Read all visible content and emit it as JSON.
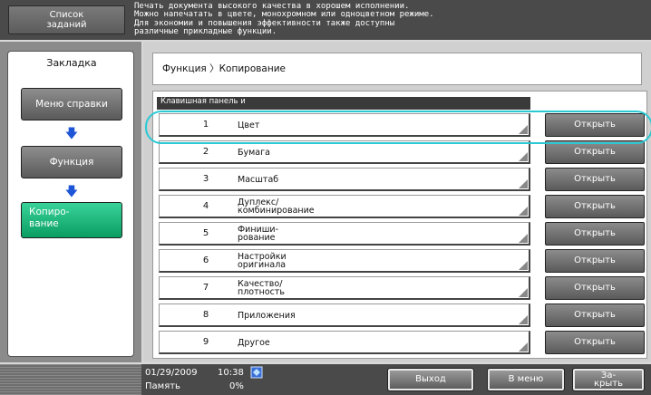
{
  "header": {
    "job_list_label": "Список\nзаданий",
    "message": "Печать документа высокого качества в хорошем исполнении.\nМожно напечатать в цвете, монохромном или одноцветном режиме.\nДля экономии и повышения эффективности также доступны\nразличные прикладные функции."
  },
  "sidebar": {
    "title": "Закладка",
    "items": [
      {
        "label": "Меню справки"
      },
      {
        "label": "Функция"
      },
      {
        "label": "Копиро-\nвание"
      }
    ],
    "arrow": "🡇"
  },
  "main": {
    "breadcrumb": "Функция 〉Копирование",
    "list_header": "Клавишная панель\nи",
    "open_label": "Открыть",
    "rows": [
      {
        "num": "1",
        "label": "Цвет"
      },
      {
        "num": "2",
        "label": "Бумага"
      },
      {
        "num": "3",
        "label": "Масштаб"
      },
      {
        "num": "4",
        "label": "Дуплекс/\nкомбинирование"
      },
      {
        "num": "5",
        "label": "Финиши-\nрование"
      },
      {
        "num": "6",
        "label": "Настройки\nоригинала"
      },
      {
        "num": "7",
        "label": "Качество/\nплотность"
      },
      {
        "num": "8",
        "label": "Приложения"
      },
      {
        "num": "9",
        "label": "Другое"
      }
    ]
  },
  "footer": {
    "date": "01/29/2009",
    "time": "10:38",
    "memory_label": "Память",
    "memory_value": "0%",
    "exit_label": "Выход",
    "to_menu_label": "В меню",
    "close_label": "За-\nкрыть"
  },
  "colors": {
    "highlight": "#2ac9d4",
    "active_nav": "#0a9d62",
    "arrow": "#1e55d6"
  }
}
